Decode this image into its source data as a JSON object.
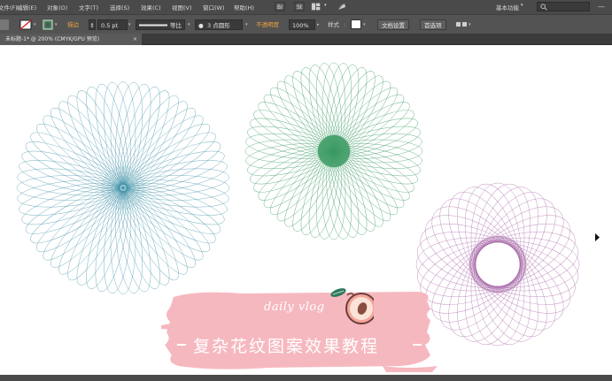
{
  "menubar": {
    "items": [
      {
        "label": "文件(F)"
      },
      {
        "label": "编辑(E)"
      },
      {
        "label": "对象(O)"
      },
      {
        "label": "文字(T)"
      },
      {
        "label": "选择(S)"
      },
      {
        "label": "效果(C)"
      },
      {
        "label": "视图(V)"
      },
      {
        "label": "窗口(W)"
      },
      {
        "label": "帮助(H)"
      }
    ],
    "workspace_label": "基本功能",
    "window_controls": {
      "minimize": "—",
      "close": "✕"
    }
  },
  "controlbar": {
    "stroke_label": "描边",
    "stroke_value": "0.5 pt",
    "profile_label": "等比",
    "brush_label": "3 点圆形",
    "opacity_label": "不透明度",
    "opacity_value": "100%",
    "style_label": "样式",
    "doc_setup_button": "文档设置",
    "preferences_button": "首选项"
  },
  "document_tab": {
    "label": "未标题-1* @ 200% (CMYK/GPU 预览)",
    "close": "×"
  },
  "banner": {
    "vlog_text": "daily vlog",
    "headline": "复杂花纹图案效果教程"
  },
  "colors": {
    "rosette_blue": "#3c8fa6",
    "rosette_green": "#3a9a62",
    "rosette_purple": "#a86aa8",
    "banner_pink": "#f6b8bf",
    "ui_dark": "#4a4a4a",
    "accent_orange": "#f0a33a"
  }
}
